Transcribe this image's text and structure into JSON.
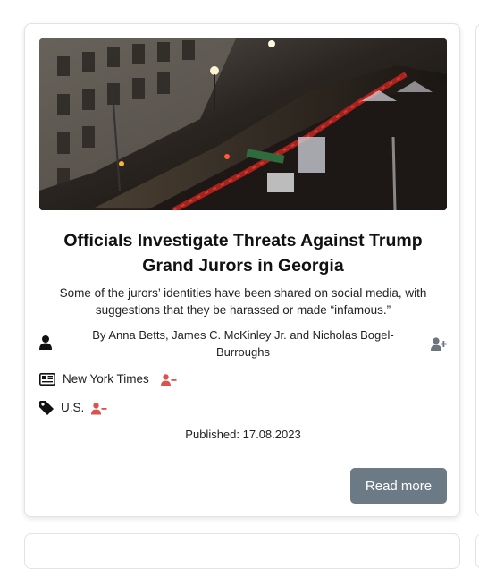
{
  "article": {
    "title": "Officials Investigate Threats Against Trump Grand Jurors in Georgia",
    "description": "Some of the jurors’ identities have been shared on social media, with suggestions that they be harassed or made “infamous.”",
    "author": "By Anna Betts, James C. McKinley Jr. and Nicholas Bogel-Burroughs",
    "source": "New York Times",
    "category": "U.S.",
    "published": "Published: 17.08.2023",
    "read_more_label": "Read more"
  },
  "icons": {
    "author": "user-icon",
    "follow_author": "user-plus-icon",
    "source": "newspaper-icon",
    "unfollow_source": "user-minus-icon",
    "category": "tag-icon",
    "unfollow_category": "user-minus-icon"
  },
  "colors": {
    "button": "#6c7a86",
    "remove_icon": "#d9534f",
    "add_icon": "#6c757d"
  }
}
